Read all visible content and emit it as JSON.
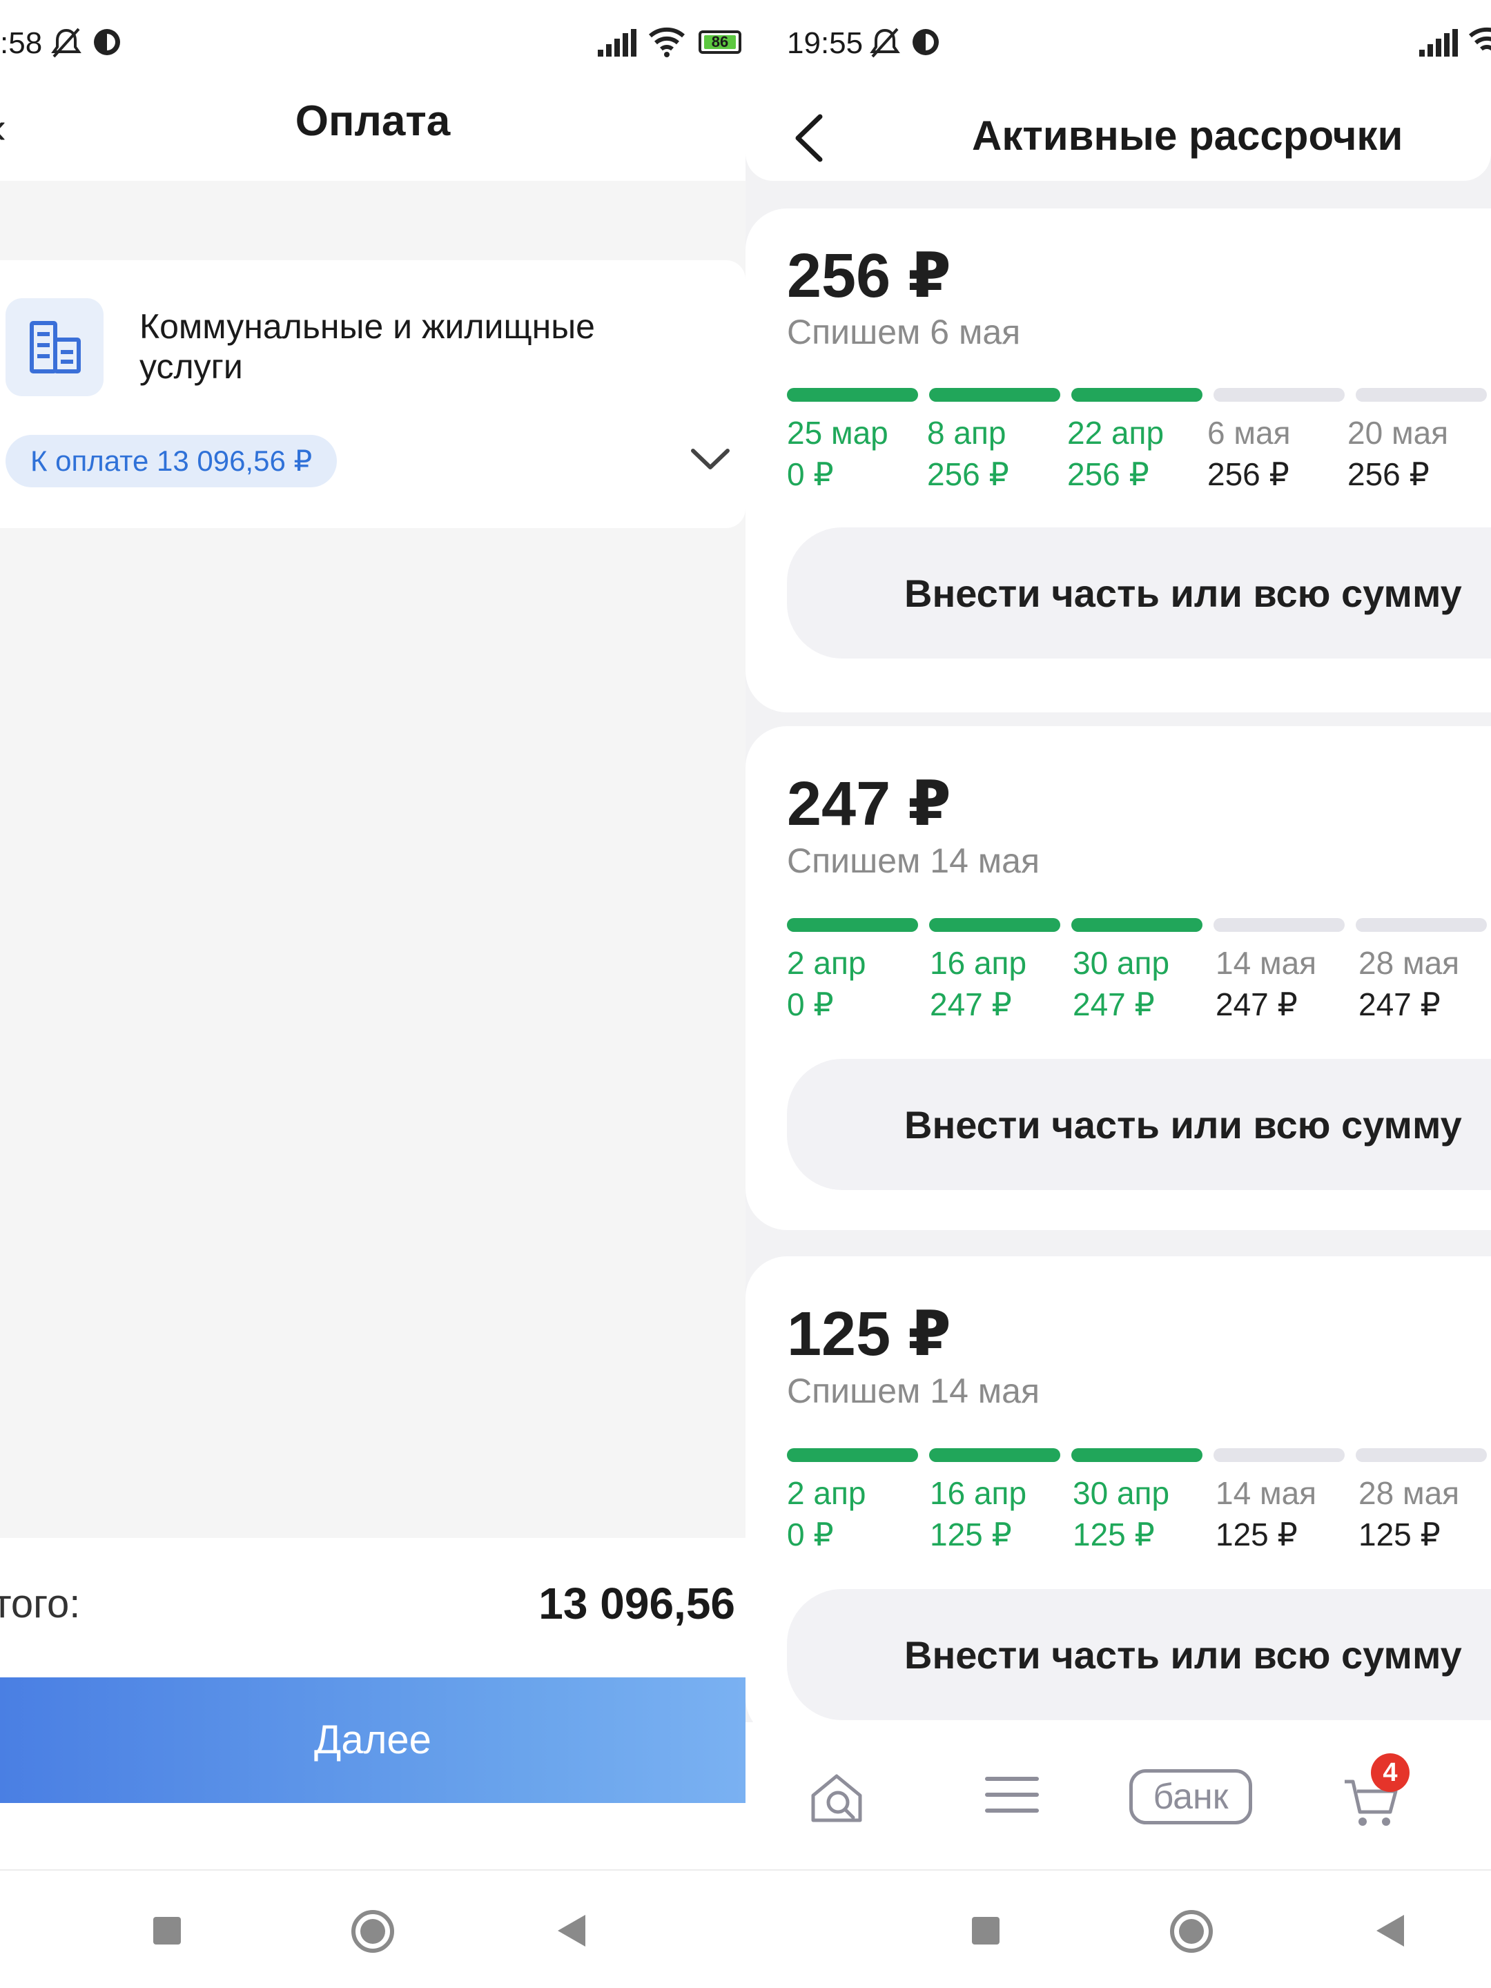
{
  "left": {
    "status": {
      "time": ":58",
      "battery": "86"
    },
    "header": {
      "title": "Оплата"
    },
    "service": {
      "icon": "building-icon",
      "title": "Коммунальные и жилищные услуги",
      "chip": "К оплате 13 096,56 ₽"
    },
    "footer": {
      "total_label": "того:",
      "total_value": "13 096,56",
      "next_label": "Далее"
    }
  },
  "right": {
    "status": {
      "time": "19:55"
    },
    "header": {
      "title": "Активные рассрочки"
    },
    "plans": [
      {
        "amount": "256 ₽",
        "charge": "Спишем 6 мая",
        "paid_segments": 3,
        "total_segments": 6,
        "schedule": [
          {
            "date": "25 мар",
            "amount": "0 ₽",
            "paid": true
          },
          {
            "date": "8 апр",
            "amount": "256 ₽",
            "paid": true
          },
          {
            "date": "22 апр",
            "amount": "256 ₽",
            "paid": true
          },
          {
            "date": "6 мая",
            "amount": "256 ₽",
            "paid": false
          },
          {
            "date": "20 мая",
            "amount": "256 ₽",
            "paid": false
          }
        ],
        "button": "Внести часть или всю сумму"
      },
      {
        "amount": "247 ₽",
        "charge": "Спишем 14 мая",
        "paid_segments": 3,
        "total_segments": 5,
        "schedule": [
          {
            "date": "2 апр",
            "amount": "0 ₽",
            "paid": true
          },
          {
            "date": "16 апр",
            "amount": "247 ₽",
            "paid": true
          },
          {
            "date": "30 апр",
            "amount": "247 ₽",
            "paid": true
          },
          {
            "date": "14 мая",
            "amount": "247 ₽",
            "paid": false
          },
          {
            "date": "28 мая",
            "amount": "247 ₽",
            "paid": false
          }
        ],
        "button": "Внести часть или всю сумму"
      },
      {
        "amount": "125 ₽",
        "charge": "Спишем 14 мая",
        "paid_segments": 3,
        "total_segments": 5,
        "schedule": [
          {
            "date": "2 апр",
            "amount": "0 ₽",
            "paid": true
          },
          {
            "date": "16 апр",
            "amount": "125 ₽",
            "paid": true
          },
          {
            "date": "30 апр",
            "amount": "125 ₽",
            "paid": true
          },
          {
            "date": "14 мая",
            "amount": "125 ₽",
            "paid": false
          },
          {
            "date": "28 мая",
            "amount": "125 ₽",
            "paid": false
          }
        ],
        "button": "Внести часть или всю сумму"
      }
    ],
    "tabbar": {
      "items": [
        "search-icon",
        "menu-icon",
        "bank-icon",
        "cart-icon"
      ],
      "bank_label": "банк",
      "cart_badge": "4"
    }
  },
  "colors": {
    "paid": "#21a65a",
    "due": "#e4e4ea",
    "accent": "#4a7fe3",
    "badge": "#e5342a"
  }
}
